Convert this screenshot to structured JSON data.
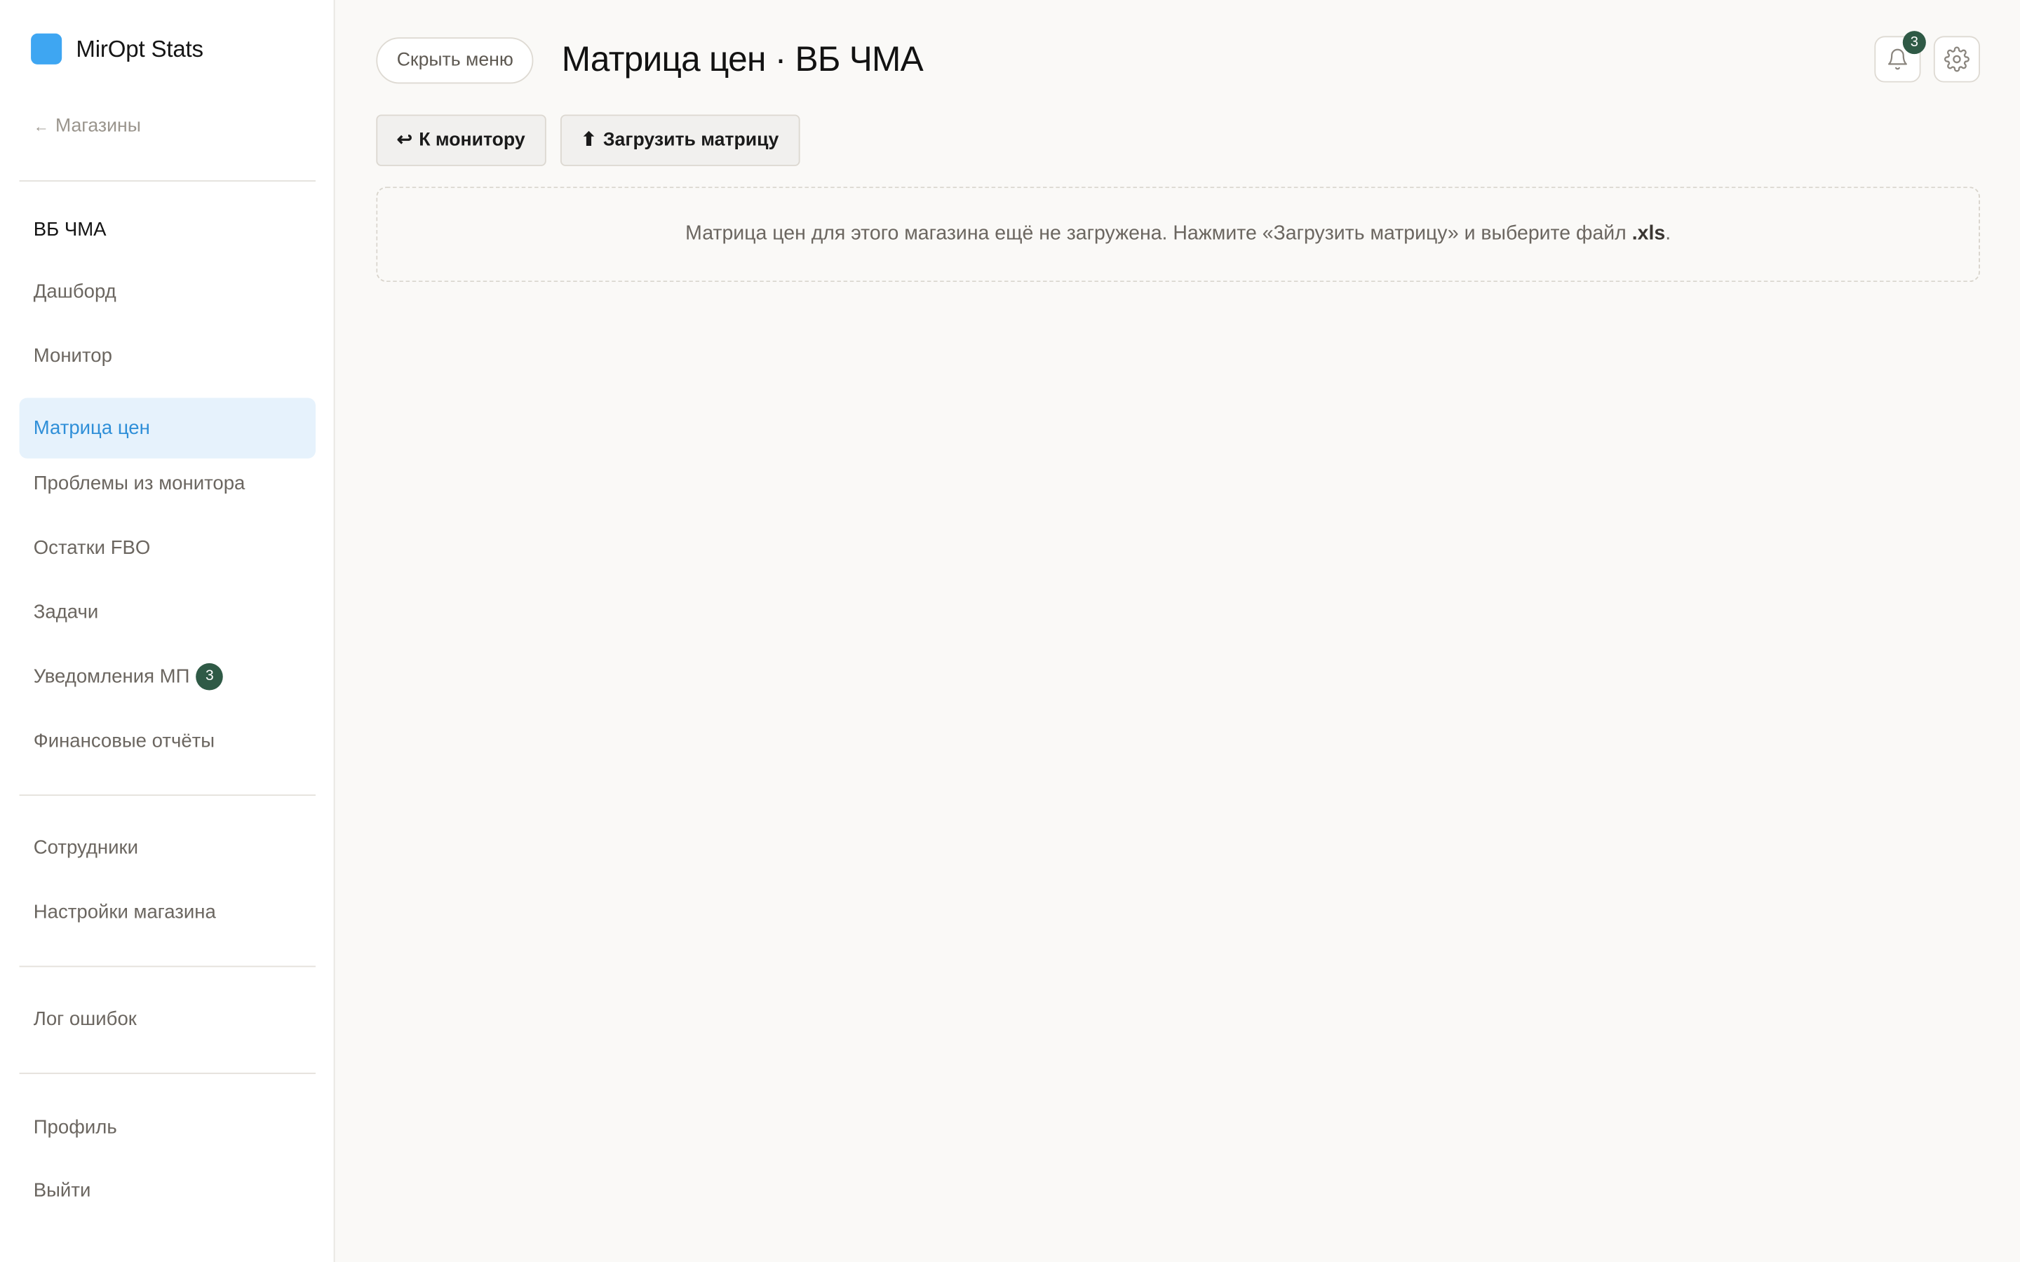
{
  "app": {
    "name": "MirOpt Stats",
    "accent_color": "#3ea6f2",
    "badge_color": "#2f5a46"
  },
  "sidebar": {
    "back_arrow": "←",
    "back_label": "Магазины",
    "store_name": "ВБ ЧМА",
    "items": [
      {
        "label": "Дашборд",
        "active": false
      },
      {
        "label": "Монитор",
        "active": false
      },
      {
        "label": "Матрица цен",
        "active": true
      },
      {
        "label": "Проблемы из монитора",
        "active": false
      },
      {
        "label": "Остатки FBO",
        "active": false
      },
      {
        "label": "Задачи",
        "active": false
      },
      {
        "label": "Уведомления МП",
        "active": false,
        "badge": "3"
      },
      {
        "label": "Финансовые отчёты",
        "active": false
      }
    ],
    "admin_items": [
      {
        "label": "Сотрудники"
      },
      {
        "label": "Настройки магазина"
      }
    ],
    "log_item": {
      "label": "Лог ошибок"
    },
    "account_items": [
      {
        "label": "Профиль"
      },
      {
        "label": "Выйти"
      }
    ]
  },
  "header": {
    "hide_menu_label": "Скрыть меню",
    "title": "Матрица цен · ВБ ЧМА",
    "notifications_count": "3",
    "bell_icon": "bell-icon",
    "settings_icon": "gear-icon"
  },
  "toolbar": {
    "back_glyph": "↩",
    "back_label": "К монитору",
    "upload_glyph": "⬆",
    "upload_label": "Загрузить матрицу"
  },
  "empty_state": {
    "text": "Матрица цен для этого магазина ещё не загружена. Нажмите «Загрузить матрицу» и выберите файл",
    "file_ext": ".xls",
    "period": "."
  }
}
